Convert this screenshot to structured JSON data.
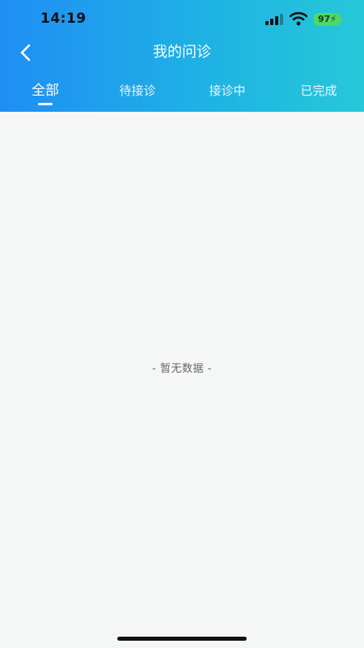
{
  "status_bar": {
    "time": "14:19",
    "battery": "97",
    "icons": [
      "signal-icon",
      "wifi-icon",
      "battery-icon"
    ]
  },
  "nav": {
    "title": "我的问诊",
    "back_icon": "chevron-left-icon"
  },
  "tabs": [
    {
      "label": "全部",
      "active": true
    },
    {
      "label": "待接诊",
      "active": false
    },
    {
      "label": "接诊中",
      "active": false
    },
    {
      "label": "已完成",
      "active": false
    }
  ],
  "content": {
    "empty_text": "- 暂无数据 -"
  },
  "colors": {
    "header_start": "#1f8ef5",
    "header_end": "#26c8d8",
    "background": "#f5f6f6",
    "battery": "#4cd964"
  }
}
